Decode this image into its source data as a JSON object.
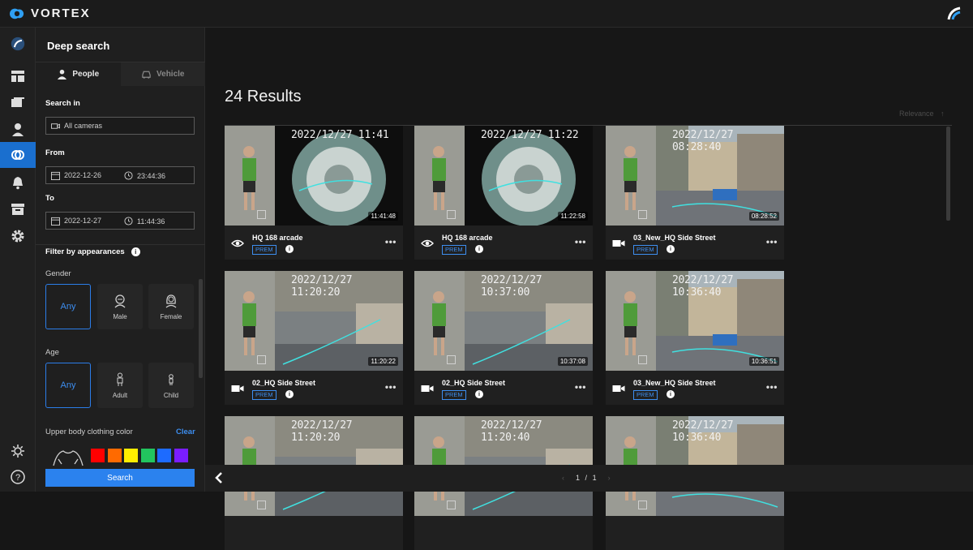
{
  "app": {
    "brand": "VORTEX"
  },
  "panel": {
    "title": "Deep search",
    "tabs": [
      {
        "label": "People",
        "active": true
      },
      {
        "label": "Vehicle",
        "active": false
      }
    ],
    "search_in": {
      "label": "Search in",
      "value": "All cameras"
    },
    "from": {
      "label": "From",
      "date": "2022-12-26",
      "time": "23:44:36"
    },
    "to": {
      "label": "To",
      "date": "2022-12-27",
      "time": "11:44:36"
    },
    "filter": {
      "title": "Filter by appearances",
      "info": "i",
      "gender": {
        "label": "Gender",
        "options": [
          "Any",
          "Male",
          "Female"
        ],
        "selected": "Any"
      },
      "age": {
        "label": "Age",
        "options": [
          "Any",
          "Adult",
          "Child"
        ],
        "selected": "Any"
      },
      "upper_color": {
        "label": "Upper body clothing color",
        "clear": "Clear",
        "colors": [
          "#ff0000",
          "#ff6a00",
          "#ffee00",
          "#22c55e",
          "#1d6bff",
          "#7a1dff"
        ]
      }
    },
    "search_button": "Search"
  },
  "results": {
    "count_label": "24 Results",
    "sort_label": "Relevance",
    "sort_arrow": "↑",
    "cards": [
      {
        "camera": "HQ 168 arcade",
        "badge": "PREM",
        "timestamp": "2022/12/27 11:41",
        "duration": "11:41:48",
        "icon": "eye-icon",
        "scene": "fisheye"
      },
      {
        "camera": "HQ 168 arcade",
        "badge": "PREM",
        "timestamp": "2022/12/27 11:22",
        "duration": "11:22:58",
        "icon": "eye-icon",
        "scene": "fisheye"
      },
      {
        "camera": "03_New_HQ Side Street",
        "badge": "PREM",
        "timestamp": "2022/12/27 08:28:40",
        "duration": "08:28:52",
        "icon": "video-camera-icon",
        "scene": "street"
      },
      {
        "camera": "02_HQ Side Street",
        "badge": "PREM",
        "timestamp": "2022/12/27 11:20:20",
        "duration": "11:20:22",
        "icon": "video-camera-icon",
        "scene": "sidewalk"
      },
      {
        "camera": "02_HQ Side Street",
        "badge": "PREM",
        "timestamp": "2022/12/27 10:37:00",
        "duration": "10:37:08",
        "icon": "video-camera-icon",
        "scene": "sidewalk"
      },
      {
        "camera": "03_New_HQ Side Street",
        "badge": "PREM",
        "timestamp": "2022/12/27 10:36:40",
        "duration": "10:36:51",
        "icon": "video-camera-icon",
        "scene": "street"
      },
      {
        "camera": "",
        "badge": "",
        "timestamp": "2022/12/27 11:20:20",
        "duration": "",
        "icon": "",
        "scene": "sidewalk"
      },
      {
        "camera": "",
        "badge": "",
        "timestamp": "2022/12/27 11:20:40",
        "duration": "",
        "icon": "",
        "scene": "sidewalk"
      },
      {
        "camera": "",
        "badge": "",
        "timestamp": "2022/12/27 10:36:40",
        "duration": "",
        "icon": "",
        "scene": "street"
      }
    ]
  },
  "pager": {
    "prev": "‹",
    "current": "1",
    "sep": "/",
    "total": "1",
    "next": "›"
  }
}
